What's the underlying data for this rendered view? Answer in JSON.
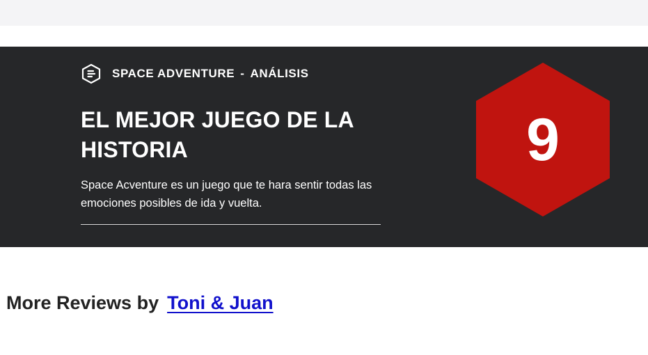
{
  "review": {
    "game_title": "SPACE ADVENTURE",
    "separator": "-",
    "section": "ANÁLISIS",
    "headline": "EL MEJOR JUEGO DE LA HISTORIA",
    "summary": "Space Acventure es un juego que te hara sentir todas las emociones posibles de ida y vuelta.",
    "score": "9",
    "icons": {
      "kicker": "document-hexagon-icon",
      "score_shape": "hexagon"
    },
    "colors": {
      "banner_bg": "#262729",
      "score_red": "#c0140f",
      "text": "#ffffff"
    }
  },
  "more_reviews": {
    "label": "More Reviews by",
    "author": "Toni & Juan",
    "link_color": "#1111cc"
  }
}
